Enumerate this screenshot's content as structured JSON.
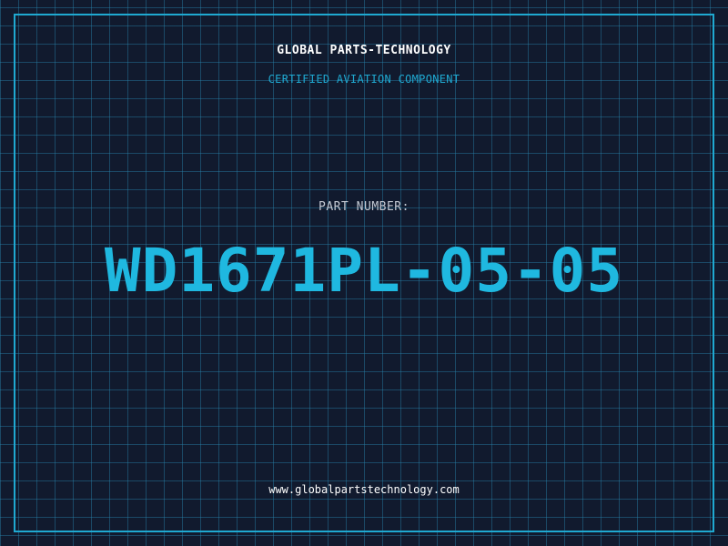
{
  "header": {
    "company": "GLOBAL PARTS-TECHNOLOGY",
    "tagline": "CERTIFIED AVIATION COMPONENT"
  },
  "part": {
    "label": "PART NUMBER:",
    "number": "WD1671PL-05-05"
  },
  "footer": {
    "website": "www.globalpartstechnology.com"
  },
  "colors": {
    "background": "#111a2e",
    "grid": "#2882aa",
    "accent": "#1fa9d1",
    "part_number": "#1fb8e0",
    "text": "#ffffff"
  }
}
